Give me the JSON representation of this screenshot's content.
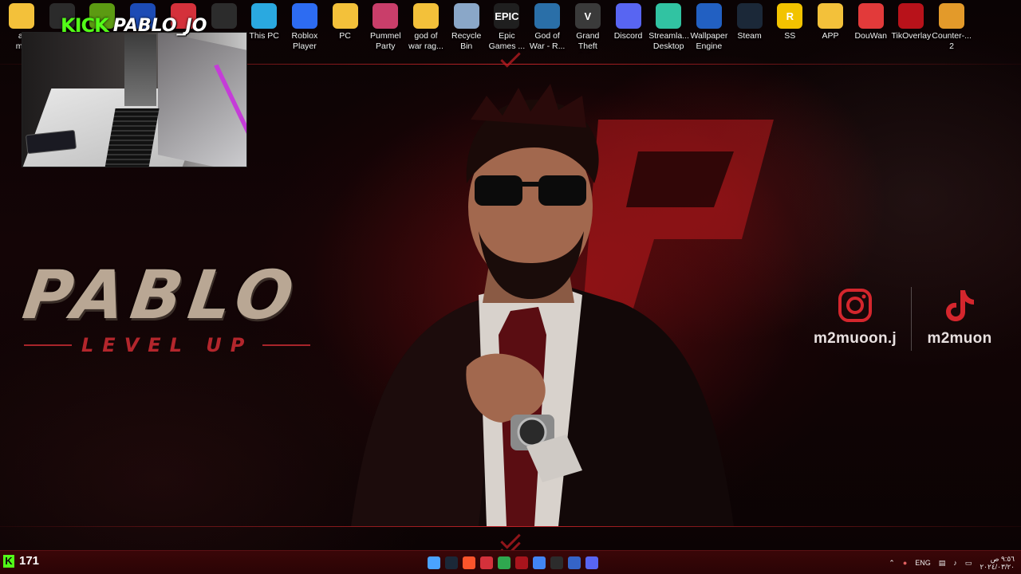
{
  "desktop_icons": [
    {
      "label": "ai\nmu",
      "icon": "folder-icon",
      "color": "#f3c13a",
      "glyph": ""
    },
    {
      "label": "",
      "icon": "app-icon",
      "color": "#2b2b2b",
      "glyph": ""
    },
    {
      "label": "",
      "icon": "nvidia-icon",
      "color": "#5c9a12",
      "glyph": ""
    },
    {
      "label": "",
      "icon": "rocket-league-icon",
      "color": "#1c4bb5",
      "glyph": ""
    },
    {
      "label": "",
      "icon": "tiktok-studio-icon",
      "color": "#d4313b",
      "glyph": ""
    },
    {
      "label": "",
      "icon": "obs-icon",
      "color": "#2c2c2c",
      "glyph": ""
    },
    {
      "label": "This PC",
      "icon": "monitor-icon",
      "color": "#2aa9e0",
      "glyph": ""
    },
    {
      "label": "Roblox\nPlayer",
      "icon": "roblox-icon",
      "color": "#2d6cf2",
      "glyph": ""
    },
    {
      "label": "PC",
      "icon": "folder-icon",
      "color": "#f3c13a",
      "glyph": ""
    },
    {
      "label": "Pummel\nParty",
      "icon": "pummel-party-icon",
      "color": "#c93e6a",
      "glyph": ""
    },
    {
      "label": "god of\nwar rag...",
      "icon": "folder-icon",
      "color": "#f3c13a",
      "glyph": ""
    },
    {
      "label": "Recycle\nBin",
      "icon": "recycle-bin-icon",
      "color": "#8aa7c8",
      "glyph": ""
    },
    {
      "label": "Epic\nGames ...",
      "icon": "epic-games-icon",
      "color": "#1f1f1f",
      "glyph": "EPIC"
    },
    {
      "label": "God of\nWar - R...",
      "icon": "god-of-war-icon",
      "color": "#2a6fa8",
      "glyph": ""
    },
    {
      "label": "Grand\nTheft Aut...",
      "icon": "gta-icon",
      "color": "#3a3a3a",
      "glyph": "V"
    },
    {
      "label": "Discord",
      "icon": "discord-icon",
      "color": "#5865f2",
      "glyph": ""
    },
    {
      "label": "Streamla...\nDesktop",
      "icon": "streamlabs-icon",
      "color": "#31c3a2",
      "glyph": ""
    },
    {
      "label": "Wallpaper\nEngine",
      "icon": "wallpaper-engine-icon",
      "color": "#2260c2",
      "glyph": ""
    },
    {
      "label": "Steam",
      "icon": "steam-icon",
      "color": "#1b2838",
      "glyph": ""
    },
    {
      "label": "SS",
      "icon": "rockstar-icon",
      "color": "#f2c300",
      "glyph": "R"
    },
    {
      "label": "APP",
      "icon": "folder-icon",
      "color": "#f3c13a",
      "glyph": ""
    },
    {
      "label": "DouWan",
      "icon": "douwan-icon",
      "color": "#e23a3a",
      "glyph": ""
    },
    {
      "label": "TikOverlay",
      "icon": "tikoverlay-icon",
      "color": "#b8121a",
      "glyph": ""
    },
    {
      "label": "Counter-...\n2",
      "icon": "counter-strike-icon",
      "color": "#e39a2a",
      "glyph": ""
    }
  ],
  "webcam": {
    "kick_logo": "KICK",
    "handle": "PABLO_JO"
  },
  "brand": {
    "title": "PABLO",
    "subtitle": "LEVEL UP"
  },
  "socials": [
    {
      "platform": "instagram",
      "icon": "instagram-icon",
      "handle": "m2muoon.j"
    },
    {
      "platform": "tiktok",
      "icon": "tiktok-icon",
      "handle": "m2muon"
    }
  ],
  "colors": {
    "accent_red": "#c8232a",
    "kick_green": "#53fc18",
    "taskbar": "#2a0405"
  },
  "taskbar": {
    "kick_viewers": "171",
    "kick_glyph": "K",
    "apps": [
      {
        "icon": "start-icon",
        "color": "#4aa3ff"
      },
      {
        "icon": "steam-icon",
        "color": "#1b2838"
      },
      {
        "icon": "brave-icon",
        "color": "#fb542b"
      },
      {
        "icon": "tiktok-studio-icon",
        "color": "#d4313b"
      },
      {
        "icon": "lock-icon",
        "color": "#2fa84f"
      },
      {
        "icon": "red-app-icon",
        "color": "#a8141c"
      },
      {
        "icon": "chrome-icon",
        "color": "#4285f4"
      },
      {
        "icon": "obs-icon",
        "color": "#2c2c2c"
      },
      {
        "icon": "shield-icon",
        "color": "#3564c7"
      },
      {
        "icon": "discord-icon",
        "color": "#5865f2"
      }
    ],
    "tray": {
      "language": "ENG",
      "time": "٩:٥٦ ص",
      "date": "٢٠٢٤/٠٣/٢٠"
    }
  }
}
